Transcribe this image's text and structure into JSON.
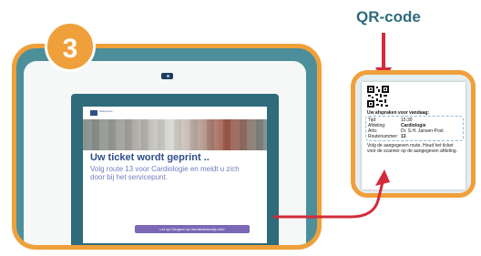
{
  "step": {
    "number": "3"
  },
  "qr_label": "QR-code",
  "kiosk": {
    "screen": {
      "logo_text": "Ziekenhuis",
      "title": "Uw ticket wordt geprint ..",
      "subtitle": "Volg route 13 voor Cardiologie en meldt u zich door bij het servicepunt.",
      "button_label": "Let op! Vergeet uw identiteitsbewijs niet!"
    }
  },
  "ticket": {
    "appointments_title": "Uw afspraken voor vandaag:",
    "rows": [
      {
        "label": "Tijd:",
        "value": "15:30"
      },
      {
        "label": "Afdeling:",
        "value": "Cardiologie"
      },
      {
        "label": "Arts:",
        "value": "Dr. S.H. Jansen-Post"
      },
      {
        "label": "Routenummer:",
        "value": "13"
      }
    ],
    "instructions": "Volg de aangegeven route. Houd het ticket voor de scanner op de aangegeven afdeling."
  },
  "colors": {
    "accent": "#f0a03a",
    "teal": "#2e6b7b",
    "arrow": "#d42b3a",
    "screen_button": "#7a67b5"
  }
}
